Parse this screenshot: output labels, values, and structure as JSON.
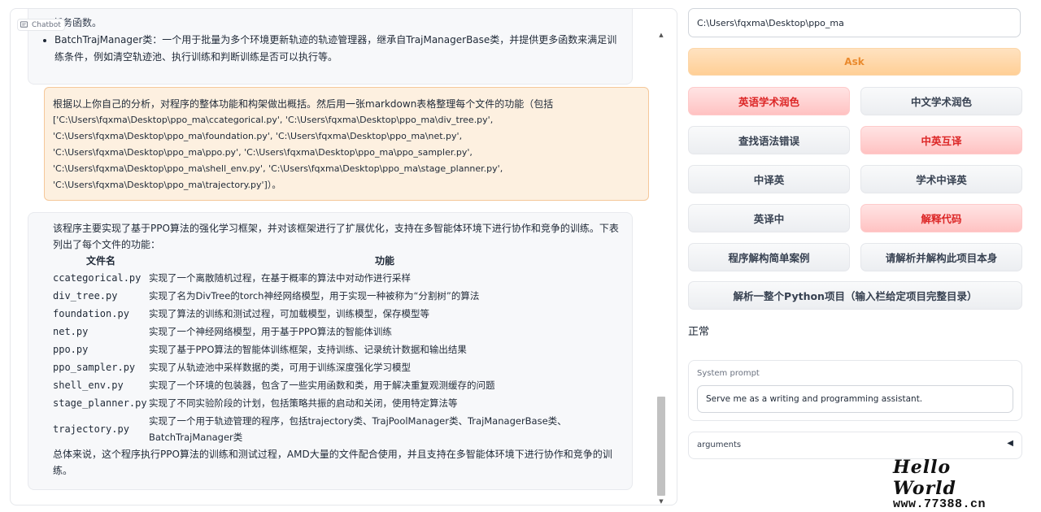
{
  "chatbot": {
    "label": "Chatbot",
    "top_message": {
      "cut_line": "任务函数。",
      "bullet": "BatchTrajManager类：一个用于批量为多个环境更新轨迹的轨迹管理器，继承自TrajManagerBase类，并提供更多函数来满足训练条件，例如清空轨迹池、执行训练和判断训练是否可以执行等。"
    },
    "user_message": {
      "intro": "根据以上你自己的分析，对程序的整体功能和构架做出概括。然后用一张markdown表格整理每个文件的功能（包括",
      "paths": [
        "['C:\\Users\\fqxma\\Desktop\\ppo_ma\\ccategorical.py', 'C:\\Users\\fqxma\\Desktop\\ppo_ma\\div_tree.py',",
        "'C:\\Users\\fqxma\\Desktop\\ppo_ma\\foundation.py', 'C:\\Users\\fqxma\\Desktop\\ppo_ma\\net.py',",
        "'C:\\Users\\fqxma\\Desktop\\ppo_ma\\ppo.py', 'C:\\Users\\fqxma\\Desktop\\ppo_ma\\ppo_sampler.py',",
        "'C:\\Users\\fqxma\\Desktop\\ppo_ma\\shell_env.py', 'C:\\Users\\fqxma\\Desktop\\ppo_ma\\stage_planner.py',",
        "'C:\\Users\\fqxma\\Desktop\\ppo_ma\\trajectory.py']）。"
      ]
    },
    "bot_message": {
      "intro": "该程序主要实现了基于PPO算法的强化学习框架，并对该框架进行了扩展优化，支持在多智能体环境下进行协作和竞争的训练。下表列出了每个文件的功能：",
      "table_headers": [
        "文件名",
        "功能"
      ],
      "rows": [
        {
          "file": "ccategorical.py",
          "func": "实现了一个离散随机过程，在基于概率的算法中对动作进行采样"
        },
        {
          "file": "div_tree.py",
          "func": "实现了名为DivTree的torch神经网络模型，用于实现一种被称为“分割树”的算法"
        },
        {
          "file": "foundation.py",
          "func": "实现了算法的训练和测试过程，可加载模型，训练模型，保存模型等"
        },
        {
          "file": "net.py",
          "func": "实现了一个神经网络模型，用于基于PPO算法的智能体训练"
        },
        {
          "file": "ppo.py",
          "func": "实现了基于PPO算法的智能体训练框架，支持训练、记录统计数据和输出结果"
        },
        {
          "file": "ppo_sampler.py",
          "func": "实现了从轨迹池中采样数据的类，可用于训练深度强化学习模型"
        },
        {
          "file": "shell_env.py",
          "func": "实现了一个环境的包装器，包含了一些实用函数和类，用于解决重复观测缓存的问题"
        },
        {
          "file": "stage_planner.py",
          "func": "实现了不同实验阶段的计划，包括策略共振的启动和关闭，使用特定算法等"
        },
        {
          "file": "trajectory.py",
          "func": "实现了一个用于轨迹管理的程序，包括trajectory类、TrajPoolManager类、TrajManagerBase类、BatchTrajManager类"
        }
      ],
      "summary": "总体来说，这个程序执行PPO算法的训练和测试过程，AMD大量的文件配合使用，并且支持在多智能体环境下进行协作和竞争的训练。"
    }
  },
  "controls": {
    "path_value": "C:\\Users\\fqxma\\Desktop\\ppo_ma",
    "ask_label": "Ask",
    "buttons": {
      "english_polish": "英语学术润色",
      "chinese_polish": "中文学术润色",
      "grammar_check": "查找语法错误",
      "cn_en_translate": "中英互译",
      "cn_to_en": "中译英",
      "academic_cn_to_en": "学术中译英",
      "en_to_cn": "英译中",
      "explain_code": "解释代码",
      "simple_case": "程序解构简单案例",
      "parse_self": "请解析并解构此项目本身",
      "parse_python_project": "解析一整个Python项目（输入栏给定项目完整目录）"
    },
    "status": "正常",
    "system_prompt_label": "System prompt",
    "system_prompt_value": "Serve me as a writing and programming assistant.",
    "arguments_label": "arguments",
    "arguments_arrow": "◀"
  },
  "watermark": {
    "title": "Hello World",
    "url": "www.77388.cn"
  }
}
